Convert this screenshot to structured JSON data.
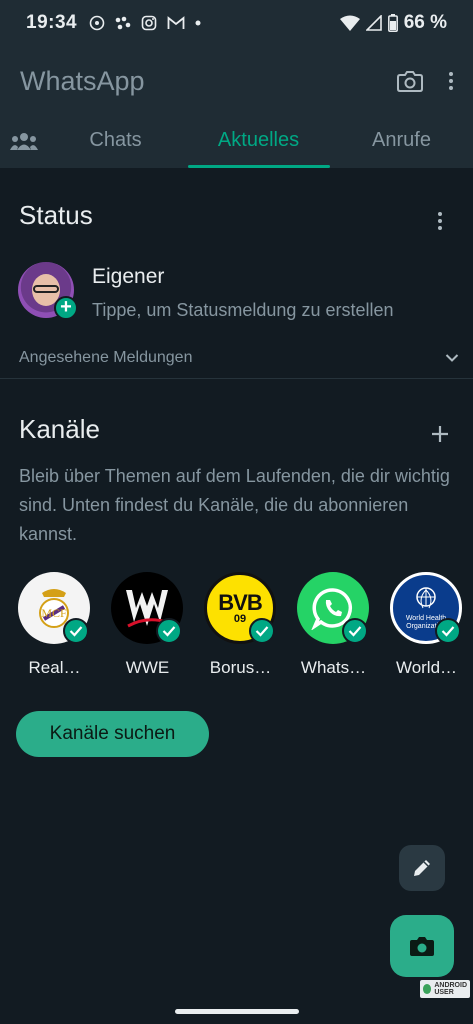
{
  "status_bar": {
    "time": "19:34",
    "notification_icons": [
      "podcast-icon",
      "assistant-icon",
      "instagram-icon",
      "gmail-icon",
      "dot-icon"
    ],
    "battery": "66 %"
  },
  "app": {
    "title": "WhatsApp"
  },
  "tabs": [
    {
      "label": "Chats",
      "active": false
    },
    {
      "label": "Aktuelles",
      "active": true
    },
    {
      "label": "Anrufe",
      "active": false
    }
  ],
  "status": {
    "title": "Status",
    "my_status": {
      "name": "Eigener",
      "subtitle": "Tippe, um Statusmeldung zu erstellen"
    },
    "viewed_label": "Angesehene Meldungen"
  },
  "channels": {
    "title": "Kanäle",
    "description": "Bleib über Themen auf dem Laufenden, die dir wichtig sind. Unten findest du Kanäle, die du abonnieren kannst.",
    "items": [
      {
        "name": "Real…",
        "logo": "real-madrid-crest"
      },
      {
        "name": "WWE",
        "logo": "wwe-logo"
      },
      {
        "name": "Borus…",
        "logo": "bvb-logo",
        "logo_text": "BVB",
        "logo_sub": "09"
      },
      {
        "name": "Whats…",
        "logo": "whatsapp-logo"
      },
      {
        "name": "World…",
        "logo": "who-logo",
        "logo_text": "World Health Organization"
      }
    ],
    "search_button": "Kanäle suchen"
  },
  "watermark": {
    "line1": "ANDROID",
    "line2": "USER"
  },
  "colors": {
    "background": "#121b22",
    "header": "#1f2c34",
    "accent": "#00a884",
    "button": "#2bad8a",
    "muted_text": "#8696a0"
  }
}
